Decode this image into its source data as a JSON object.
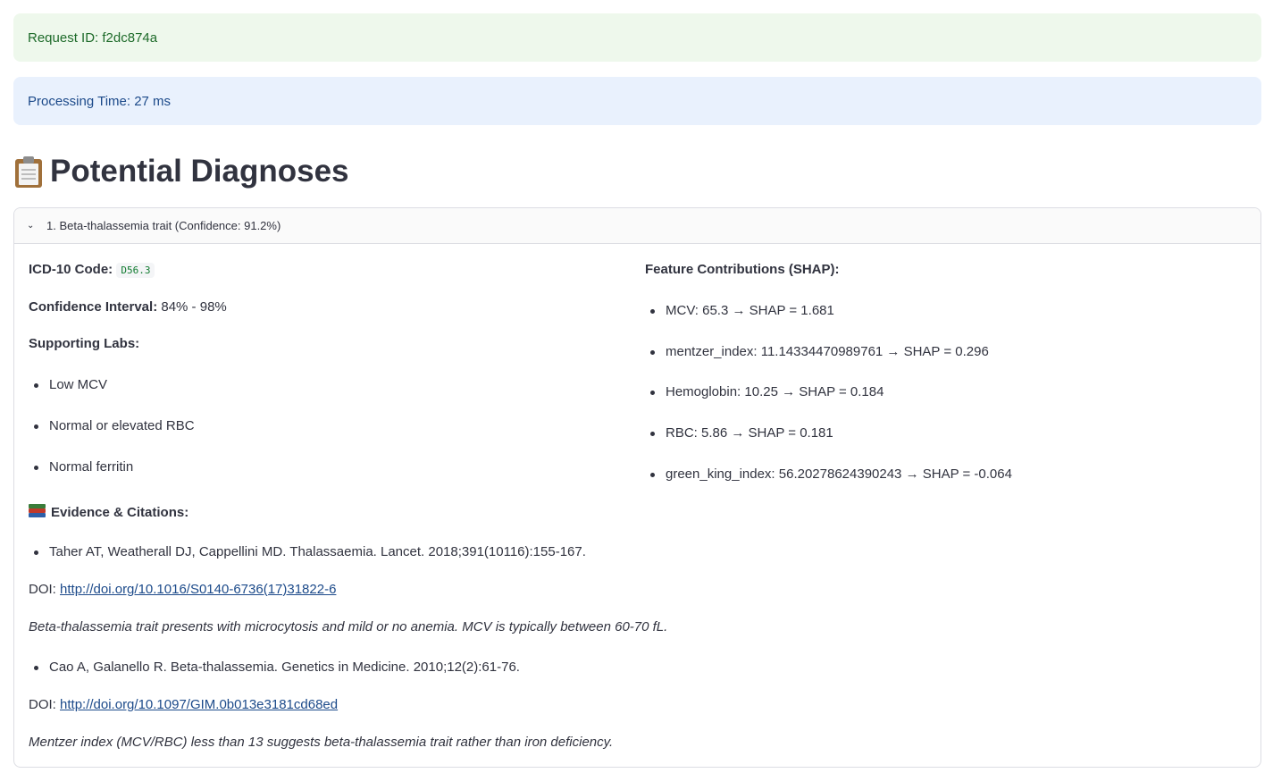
{
  "alerts": {
    "request_id": "Request ID: f2dc874a",
    "processing_time": "Processing Time: 27 ms"
  },
  "heading": {
    "title": "Potential Diagnoses",
    "icon": "clipboard-icon"
  },
  "diagnosis": {
    "header": "1. Beta-thalassemia trait (Confidence: 91.2%)",
    "icd_label": "ICD-10 Code:",
    "icd_code": "D56.3",
    "ci_label": "Confidence Interval:",
    "ci_value": " 84% - 98%",
    "supporting_labs_label": "Supporting Labs:",
    "supporting_labs": [
      "Low MCV",
      "Normal or elevated RBC",
      "Normal ferritin"
    ],
    "evidence_label": "Evidence & Citations:",
    "citations": [
      {
        "ref": "Taher AT, Weatherall DJ, Cappellini MD. Thalassaemia. Lancet. 2018;391(10116):155-167.",
        "doi_label": "DOI: ",
        "doi": "http://doi.org/10.1016/S0140-6736(17)31822-6",
        "note": "Beta-thalassemia trait presents with microcytosis and mild or no anemia. MCV is typically between 60-70 fL."
      },
      {
        "ref": "Cao A, Galanello R. Beta-thalassemia. Genetics in Medicine. 2010;12(2):61-76.",
        "doi_label": "DOI: ",
        "doi": "http://doi.org/10.1097/GIM.0b013e3181cd68ed",
        "note": "Mentzer index (MCV/RBC) less than 13 suggests beta-thalassemia trait rather than iron deficiency."
      }
    ],
    "shap_label": "Feature Contributions (SHAP):",
    "shap": [
      "MCV: 65.3 → SHAP = 1.681",
      "mentzer_index: 11.14334470989761 → SHAP = 0.296",
      "Hemoglobin: 10.25 → SHAP = 0.184",
      "RBC: 5.86 → SHAP = 0.181",
      "green_king_index: 56.20278624390243 → SHAP = -0.064"
    ]
  }
}
